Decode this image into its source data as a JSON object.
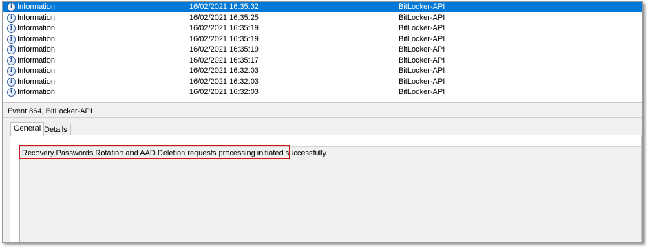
{
  "events": {
    "rows": [
      {
        "level": "Information",
        "date": "16/02/2021 16:35:32",
        "source": "BitLocker-API",
        "selected": true
      },
      {
        "level": "Information",
        "date": "16/02/2021 16:35:25",
        "source": "BitLocker-API",
        "selected": false
      },
      {
        "level": "Information",
        "date": "16/02/2021 16:35:19",
        "source": "BitLocker-API",
        "selected": false
      },
      {
        "level": "Information",
        "date": "16/02/2021 16:35:19",
        "source": "BitLocker-API",
        "selected": false
      },
      {
        "level": "Information",
        "date": "16/02/2021 16:35:19",
        "source": "BitLocker-API",
        "selected": false
      },
      {
        "level": "Information",
        "date": "16/02/2021 16:35:17",
        "source": "BitLocker-API",
        "selected": false
      },
      {
        "level": "Information",
        "date": "16/02/2021 16:32:03",
        "source": "BitLocker-API",
        "selected": false
      },
      {
        "level": "Information",
        "date": "16/02/2021 16:32:03",
        "source": "BitLocker-API",
        "selected": false
      },
      {
        "level": "Information",
        "date": "16/02/2021 16:32:03",
        "source": "BitLocker-API",
        "selected": false
      }
    ],
    "info_icon_glyph": "i",
    "icon": "info-icon",
    "selection_color": "#0078d7"
  },
  "detail": {
    "header": "Event 864, BitLocker-API",
    "tabs": {
      "general": "General",
      "details": "Details"
    },
    "active_tab": "General",
    "message": "Recovery Passwords Rotation and AAD Deletion requests processing initiated successfully",
    "highlight_color": "#d0121b"
  }
}
